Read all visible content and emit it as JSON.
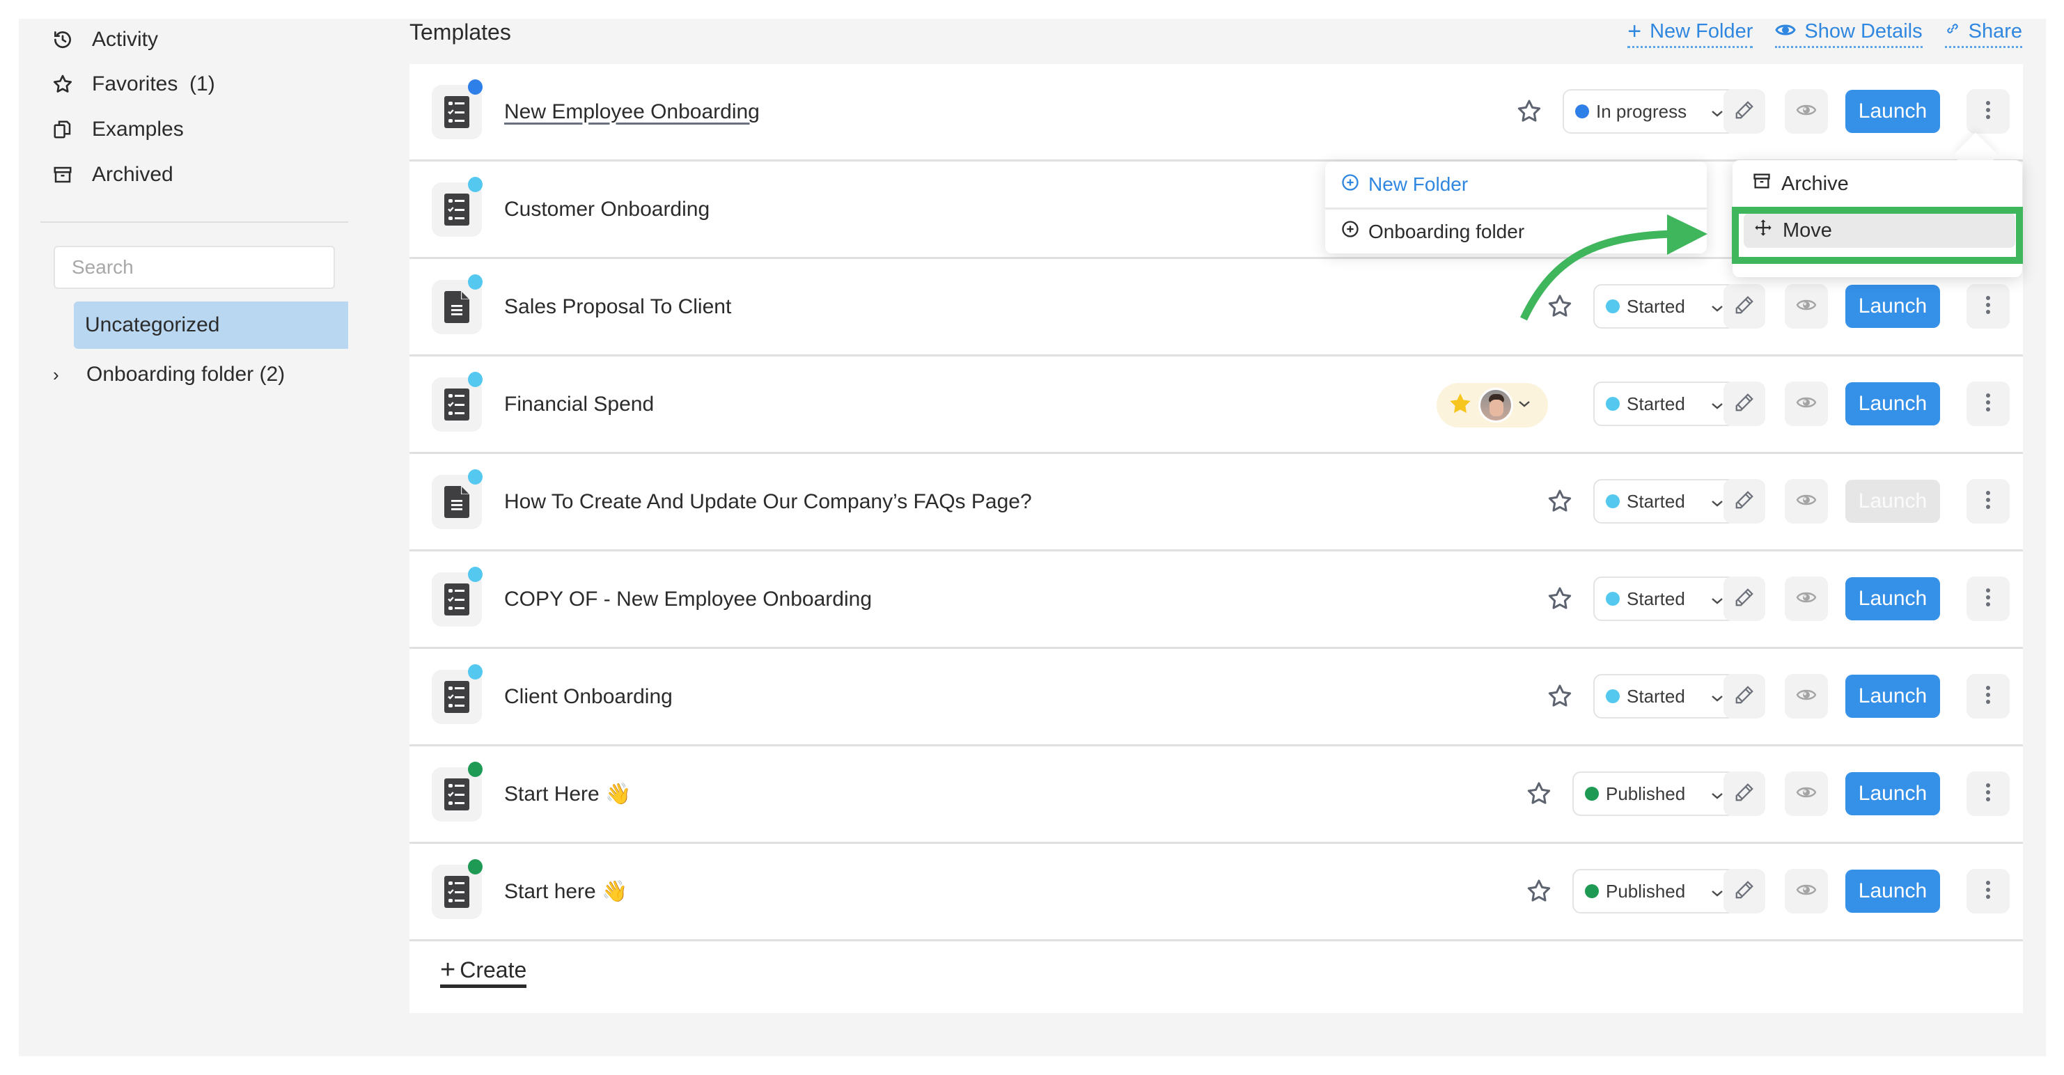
{
  "sidebar": {
    "nav": [
      {
        "label": "Activity",
        "icon": "history-icon"
      },
      {
        "label": "Favorites  (1)",
        "icon": "star-icon"
      },
      {
        "label": "Examples",
        "icon": "copy-icon"
      },
      {
        "label": "Archived",
        "icon": "archive-icon"
      }
    ],
    "search_placeholder": "Search",
    "selected_folder": "Uncategorized",
    "folders": [
      {
        "label": "Onboarding folder (2)"
      }
    ]
  },
  "header": {
    "title": "Templates",
    "links": [
      {
        "label": "New Folder",
        "icon": "plus-icon"
      },
      {
        "label": "Show Details",
        "icon": "eye-icon"
      },
      {
        "label": "Share",
        "icon": "link-icon"
      }
    ]
  },
  "colors": {
    "accent": "#3590e8",
    "in_progress": "#2f7fe8",
    "started": "#55c8f0",
    "published": "#1f9a55",
    "highlight": "#3fb55c"
  },
  "templates": [
    {
      "name": "New Employee Onboarding",
      "icon": "checklist-icon",
      "status": "In progress",
      "status_color": "#2f7fe8",
      "launch": "Launch",
      "launch_enabled": true,
      "favorite": false
    },
    {
      "name": "Customer Onboarding",
      "icon": "checklist-icon",
      "status": "",
      "status_color": "#55c8f0",
      "launch": "Launch",
      "launch_enabled": true,
      "favorite": false
    },
    {
      "name": "Sales Proposal To Client",
      "icon": "document-icon",
      "status": "Started",
      "status_color": "#55c8f0",
      "launch": "Launch",
      "launch_enabled": true,
      "favorite": false
    },
    {
      "name": "Financial Spend",
      "icon": "checklist-icon",
      "status": "Started",
      "status_color": "#55c8f0",
      "launch": "Launch",
      "launch_enabled": true,
      "favorite": true
    },
    {
      "name": "How To Create And Update Our Company’s FAQs Page?",
      "icon": "document-icon",
      "status": "Started",
      "status_color": "#55c8f0",
      "launch": "Launch",
      "launch_enabled": false,
      "favorite": false
    },
    {
      "name": "COPY OF - New Employee Onboarding",
      "icon": "checklist-icon",
      "status": "Started",
      "status_color": "#55c8f0",
      "launch": "Launch",
      "launch_enabled": true,
      "favorite": false
    },
    {
      "name": "Client Onboarding",
      "icon": "checklist-icon",
      "status": "Started",
      "status_color": "#55c8f0",
      "launch": "Launch",
      "launch_enabled": true,
      "favorite": false
    },
    {
      "name": "Start Here 👋",
      "icon": "checklist-icon",
      "status": "Published",
      "status_color": "#1f9a55",
      "launch": "Launch",
      "launch_enabled": true,
      "favorite": false
    },
    {
      "name": "Start here 👋",
      "icon": "checklist-icon",
      "status": "Published",
      "status_color": "#1f9a55",
      "launch": "Launch",
      "launch_enabled": true,
      "favorite": false
    }
  ],
  "create_label": "Create",
  "move_submenu": {
    "items": [
      {
        "label": "New Folder",
        "icon": "plus-circle-icon",
        "color": "#2f87e0"
      },
      {
        "label": "Onboarding folder",
        "icon": "plus-circle-icon",
        "color": "#2b2b2b"
      }
    ]
  },
  "context_menu": {
    "items": [
      {
        "label": "Archive",
        "icon": "archive-icon"
      },
      {
        "label": "Move",
        "icon": "move-icon",
        "highlighted": true
      }
    ]
  }
}
